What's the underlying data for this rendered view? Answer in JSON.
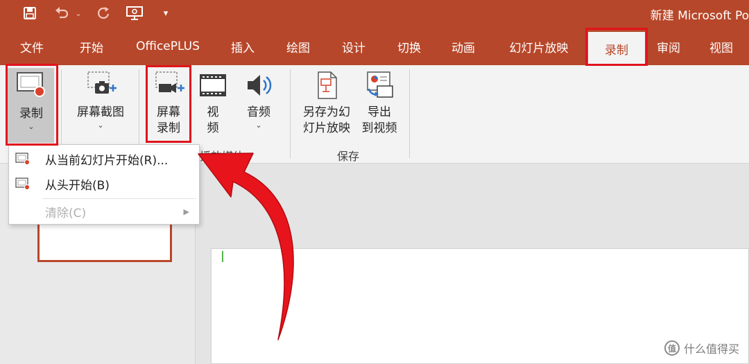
{
  "window": {
    "title": "新建 Microsoft Po",
    "accent_color": "#b7472a",
    "highlight_color": "#e1141c"
  },
  "quick_access": [
    {
      "name": "save-icon"
    },
    {
      "name": "undo-icon"
    },
    {
      "name": "redo-icon"
    },
    {
      "name": "presentation-icon"
    },
    {
      "name": "customize-chevron-icon"
    }
  ],
  "tabs": [
    {
      "label": "文件",
      "active": false
    },
    {
      "label": "开始",
      "active": false
    },
    {
      "label": "OfficePLUS",
      "active": false
    },
    {
      "label": "插入",
      "active": false
    },
    {
      "label": "绘图",
      "active": false
    },
    {
      "label": "设计",
      "active": false
    },
    {
      "label": "切换",
      "active": false
    },
    {
      "label": "动画",
      "active": false
    },
    {
      "label": "幻灯片放映",
      "active": false
    },
    {
      "label": "录制",
      "active": true
    },
    {
      "label": "审阅",
      "active": false
    },
    {
      "label": "视图",
      "active": false
    }
  ],
  "ribbon": {
    "record_label": "录制",
    "screenshot_label": "屏幕截图",
    "screen_record_line1": "屏幕",
    "screen_record_line2": "录制",
    "video_line1": "视",
    "video_line2": "频",
    "audio_label": "音频",
    "save_as_show_line1": "另存为幻",
    "save_as_show_line2": "灯片放映",
    "export_video_line1": "导出",
    "export_video_line2": "到视频",
    "group_media": "播放媒体",
    "group_save": "保存"
  },
  "record_menu": {
    "items": [
      {
        "label": "从当前幻灯片开始(R)...",
        "enabled": true
      },
      {
        "label": "从头开始(B)",
        "enabled": true
      },
      {
        "label": "清除(C)",
        "enabled": false
      }
    ]
  },
  "watermark": {
    "badge": "值",
    "text": "什么值得买"
  }
}
